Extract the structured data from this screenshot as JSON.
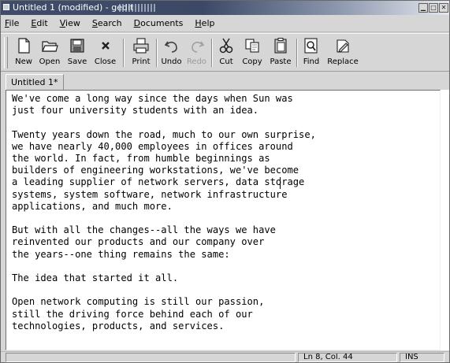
{
  "window": {
    "title": "Untitled 1 (modified) - gedit",
    "buttons": [
      "minimize",
      "maximize",
      "close"
    ]
  },
  "menubar": {
    "items": [
      {
        "label": "File",
        "mnemonic": "F",
        "rest": "ile"
      },
      {
        "label": "Edit",
        "mnemonic": "E",
        "rest": "dit"
      },
      {
        "label": "View",
        "mnemonic": "V",
        "rest": "iew"
      },
      {
        "label": "Search",
        "mnemonic": "S",
        "rest": "earch"
      },
      {
        "label": "Documents",
        "mnemonic": "D",
        "rest": "ocuments"
      },
      {
        "label": "Help",
        "mnemonic": "H",
        "rest": "elp"
      }
    ]
  },
  "toolbar": {
    "buttons": [
      {
        "label": "New",
        "icon": "new-document-icon",
        "enabled": true
      },
      {
        "label": "Open",
        "icon": "open-folder-icon",
        "enabled": true
      },
      {
        "label": "Save",
        "icon": "save-disk-icon",
        "enabled": true
      },
      {
        "label": "Close",
        "icon": "close-x-icon",
        "enabled": true
      },
      {
        "label": "Print",
        "icon": "printer-icon",
        "enabled": true
      },
      {
        "label": "Undo",
        "icon": "undo-arrow-icon",
        "enabled": true
      },
      {
        "label": "Redo",
        "icon": "redo-arrow-icon",
        "enabled": false
      },
      {
        "label": "Cut",
        "icon": "scissors-icon",
        "enabled": true
      },
      {
        "label": "Copy",
        "icon": "copy-icon",
        "enabled": true
      },
      {
        "label": "Paste",
        "icon": "paste-clipboard-icon",
        "enabled": true
      },
      {
        "label": "Find",
        "icon": "find-magnifier-icon",
        "enabled": true
      },
      {
        "label": "Replace",
        "icon": "replace-icon",
        "enabled": true
      }
    ]
  },
  "tabs": [
    {
      "label": "Untitled 1*",
      "active": true
    }
  ],
  "editor": {
    "lines": [
      "We've come a long way since the days when Sun was",
      "just four university students with an idea.",
      "",
      "Twenty years down the road, much to our own surprise,",
      "we have nearly 40,000 employees in offices around",
      "the world. In fact, from humble beginnings as",
      "builders of engineering workstations, we've become",
      "a leading supplier of network servers, data storage",
      "systems, system software, network infrastructure",
      "applications, and much more.",
      "",
      "But with all the changes--all the ways we have",
      "reinvented our products and our company over",
      "the years--one thing remains the same:",
      "",
      "The idea that started it all.",
      "",
      "Open network computing is still our passion,",
      "still the driving force behind each of our",
      "technologies, products, and services."
    ]
  },
  "statusbar": {
    "message": "",
    "position": "Ln 8, Col. 44",
    "mode": "INS"
  },
  "colors": {
    "titlebar_start": "#3f4d6b",
    "window_bg": "#d6d6d6",
    "editor_bg": "#ffffff",
    "disabled_text": "#9a9a9a"
  }
}
